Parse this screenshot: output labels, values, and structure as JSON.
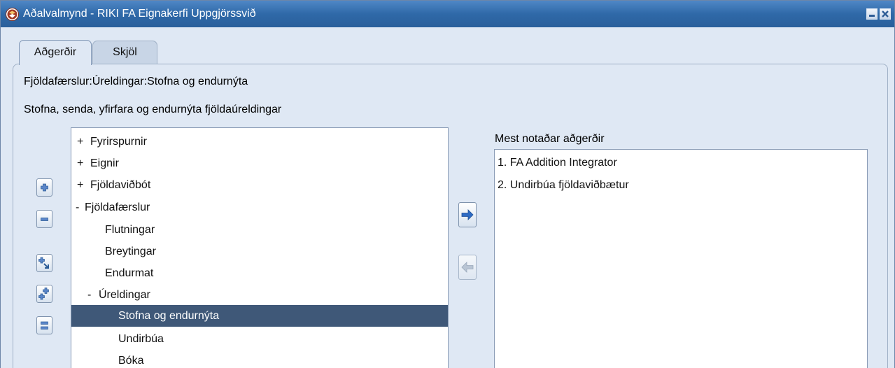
{
  "window": {
    "title": "Aðalvalmynd - RIKI FA Eignakerfi Uppgjörssvið",
    "app_icon": "oracle-app-icon",
    "controls": [
      "minimize-icon",
      "close-icon"
    ],
    "colors": {
      "titlebar": "#2f69a8",
      "panel": "#dfe8f4",
      "selection": "#3f5878",
      "arrow": "#2e6bc4"
    }
  },
  "tabs": [
    {
      "label": "Aðgerðir",
      "active": true
    },
    {
      "label": "Skjöl",
      "active": false
    }
  ],
  "breadcrumb": "Fjöldafærslur:Úreldingar:Stofna og endurnýta",
  "description": "Stofna, senda, yfirfara og endurnýta fjöldaúreldingar",
  "tree": {
    "items": [
      {
        "marker": "+",
        "label": "Fyrirspurnir",
        "level": 0
      },
      {
        "marker": "+",
        "label": "Eignir",
        "level": 0
      },
      {
        "marker": "+",
        "label": "Fjöldaviðbót",
        "level": 0
      },
      {
        "marker": "-",
        "label": "Fjöldafærslur",
        "level": 0
      },
      {
        "marker": "",
        "label": "Flutningar",
        "level": 1
      },
      {
        "marker": "",
        "label": "Breytingar",
        "level": 1
      },
      {
        "marker": "",
        "label": "Endurmat",
        "level": 1
      },
      {
        "marker": "-",
        "label": "Úreldingar",
        "level": 1
      },
      {
        "marker": "",
        "label": "Stofna og endurnýta",
        "level": 2,
        "selected": true
      },
      {
        "marker": "",
        "label": "Undirbúa",
        "level": 2
      },
      {
        "marker": "",
        "label": "Bóka",
        "level": 2
      }
    ]
  },
  "tree_buttons": [
    "expand-icon",
    "collapse-icon",
    "expand-branch-icon",
    "expand-all-icon",
    "collapse-all-icon"
  ],
  "favorites": {
    "title": "Mest notaðar aðgerðir",
    "items": [
      "1. FA Addition Integrator",
      "2. Undirbúa fjöldaviðbætur"
    ]
  },
  "transfer_buttons": [
    "add-to-favorites-arrow-icon",
    "remove-from-favorites-arrow-icon"
  ]
}
